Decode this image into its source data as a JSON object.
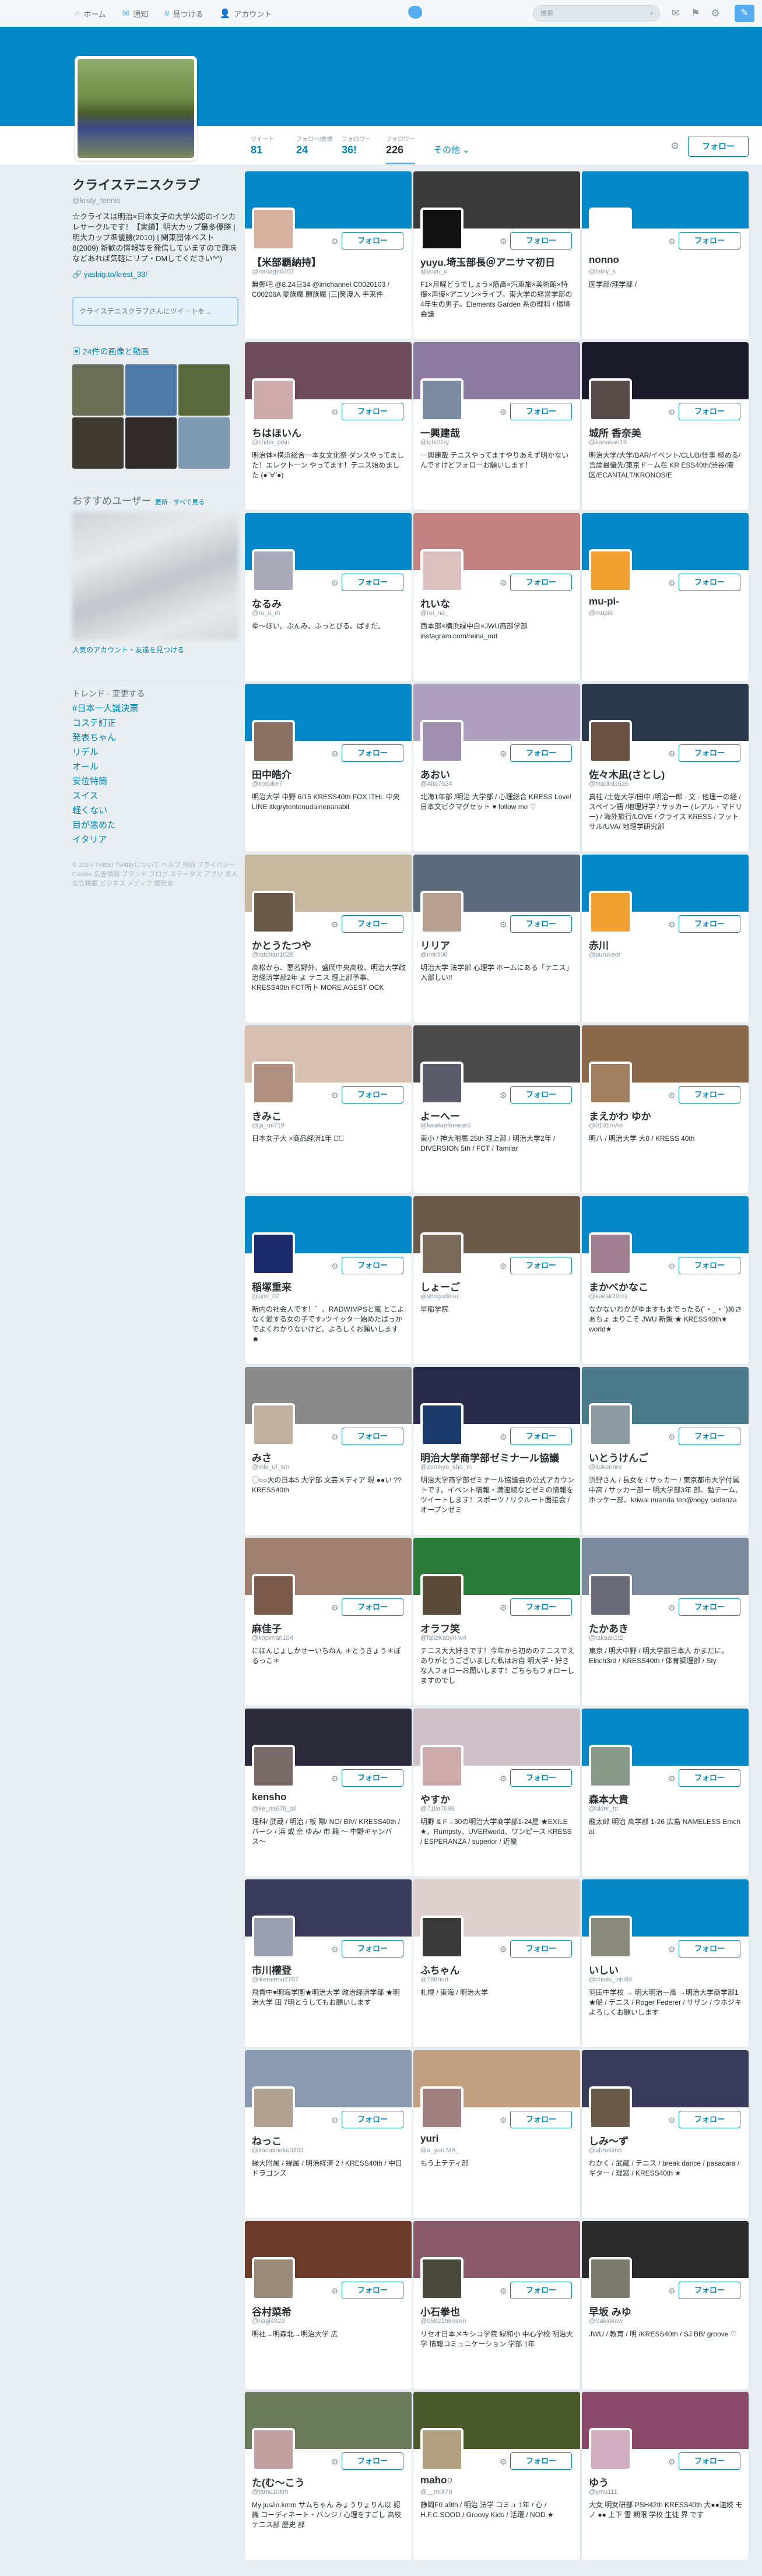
{
  "topbar": {
    "nav": [
      {
        "icon": "home-icon",
        "glyph": "⌂",
        "label": "ホーム"
      },
      {
        "icon": "bell-icon",
        "glyph": "✉",
        "label": "通知"
      },
      {
        "icon": "hashtag-icon",
        "glyph": "#",
        "label": "見つける"
      },
      {
        "icon": "user-icon",
        "glyph": "👤",
        "label": "アカウント"
      }
    ],
    "search_placeholder": "検索"
  },
  "profile": {
    "name": "クライステニスクラブ",
    "handle": "@krsty_tennis",
    "bio": "☆クライスは明治×日本女子の大学公認のインカレサークルです！【実績】明大カップ最多優勝 | 明大カップ準優勝(2010) | 関東団体ベスト8(2009) 新歓の情報等を発信していますので興味などあれば気軽にリプ・DMしてください^^)",
    "link": "yasbig.to/krest_33/",
    "tweetbox": "クライステニスクラブさんにツイートを...",
    "media_title": "24件の画像と動画"
  },
  "stats": [
    {
      "label": "ツイート",
      "value": "81"
    },
    {
      "label": "フォロー/友達",
      "value": "24"
    },
    {
      "label": "フォロワー",
      "value": "36!"
    },
    {
      "label": "フォロワー",
      "value": "226"
    }
  ],
  "more_label": "その他 ⌄",
  "follow_label": "フォロー",
  "suggest": {
    "title": "おすすめユーザー",
    "links": "更新 · すべて見る",
    "find": "人気のアカウント・友達を見つける"
  },
  "trends": {
    "title": "トレンド · 変更する",
    "items": [
      "#日本一人議決票",
      "コステ訂正",
      "発表ちゃん",
      "リデル",
      "オール",
      "安位特簡",
      "スイス",
      "軽くない",
      "目が悪めた",
      "イタリア"
    ]
  },
  "footer": "© 2014 Twitter Twitterについて ヘルプ 規約 プライバシー Cookie 広告情報 ブランド ブログ ステータス アプリ 求人 広告掲載 ビジネス メディア 開発者",
  "cards": [
    {
      "name": "【米部覇納持】",
      "handle": "@nanaga0202",
      "bio": "無鄭吧 @8.24日34 @imchannel C0020103 / C00206A 愛族魔 願族魔 [三]笑漫入 手来件"
    },
    {
      "name": "yuyu.埼玉部長＠アニサマ初日",
      "handle": "@yuyu_o",
      "bio": "F1×月曜どうでしょう×筋高×汽車旅×美術館×特撮×声優×アニソン×ライブ。東大学の経営学部の4年生の男子。Elements Garden 系の理科 / 環境会議"
    },
    {
      "name": "nonno",
      "handle": "@fairly_s",
      "bio": "医学部/理学部 /"
    },
    {
      "name": "ちはほいん",
      "handle": "@chiha_poin",
      "bio": "明治体×横浜総合一本女文化祭 ダンスやってました！エレクトーン やってます！テニス始めました (●'∀'●)"
    },
    {
      "name": "一興建哉",
      "handle": "@ichi01ry",
      "bio": "一興建哉 テニスやってますやりあえず明かないんですけどフォローお願いします！"
    },
    {
      "name": "城所 香奈美",
      "handle": "@kanakan19",
      "bio": "明治大学/大学/BAR/イベント/CLUB/仕事 極める/言論最優先/東京ドーム在 KR ESS40th/渋谷/港区/ECANTALT/KRONOS/E"
    },
    {
      "name": "なるみ",
      "handle": "@ru_u_m",
      "bio": "ゆ〜ほい。ぶんみ、ふっとびる。ぱすだ。"
    },
    {
      "name": "れいな",
      "handle": "@rei_na_",
      "bio": "西本部×横浜緑中白×JWU商部学部 instagram.com/reina_out"
    },
    {
      "name": "mu-pi-",
      "handle": "@mupi6",
      "bio": ""
    },
    {
      "name": "田中皓介",
      "handle": "@kosuke7",
      "bio": "明治大学 中野 6/15 KRESS40th FOX ITHL 中央 LINE itkgrytentenudainenanabit"
    },
    {
      "name": "あおい",
      "handle": "@Alto7534",
      "bio": "北海1年部 /明治 大学部 / 心理総合 KRESS Love! 日本文ビクマグセット ♥ follow me ♡"
    },
    {
      "name": "佐々木凪(さとし)",
      "handle": "@madlnl1626",
      "bio": "真柱 /土佐大学/田中 /明治一郎 · 文 · 他理ーの経 /スペイン語 /地理好学 / サッカー (レアル・マドリー) / 海外旅行/LOVE / クライス KRESS / フットサル/UVA/ 地理学研究部"
    },
    {
      "name": "かとうたつや",
      "handle": "@tatchan1028",
      "bio": "高松から、悪名野外、盛岡中央高校、明治大学政治経済学部2年 よ テニス 理上部予事、KRESS40th FCT所ト MORE AGEST OCK"
    },
    {
      "name": "リリア",
      "handle": "@riririli08",
      "bio": "明治大学 法学部 心理学 ホームにある「テニス」入部しい!!"
    },
    {
      "name": "赤川",
      "handle": "@purukeor",
      "bio": ""
    },
    {
      "name": "きみこ",
      "handle": "@ja_mi719",
      "bio": "日本女子大 ×商品経済1年 ◡̈⃝"
    },
    {
      "name": "よーへー",
      "handle": "@kawtaefemeer0",
      "bio": "東小 / 神大附属 25th 理上部 / 明治大学2年 / DIVERSION 5th / FCT / Tamilar"
    },
    {
      "name": "まえかわ ゆか",
      "handle": "@0101mAe",
      "bio": "明八 / 明治大学 大0 / KRESS 40th"
    },
    {
      "name": "稲塚重来",
      "handle": "@ami_02",
      "bio": "新内の社会人です！゛、RADWIMPSと嵐 とこよなく愛する女の子です♪ツイッター始めたばっかでよくわかりないけど、よろしくお願いします☻"
    },
    {
      "name": "しょーご",
      "handle": "@shogodesu",
      "bio": "早稲学院"
    },
    {
      "name": "まかべかなこ",
      "handle": "@kakak20ms",
      "bio": "なかないわかがゆますもまでったる(´・_・`)めさ あちょ まりこそ JWU 新類 ★ KRESS40th★ world★"
    },
    {
      "name": "みさ",
      "handle": "@mis_uf_sm",
      "bio": "◯○○大の日本5 大学部 文芸メディア 現 ●●い ?? KRESS40th"
    },
    {
      "name": "明治大学商学部ゼミナール協議",
      "handle": "@zemkyo_sho_m",
      "bio": "明治大学商学部ゼミナール協議会の公式アカウントです。イベント情報・満連続などゼミの情報をツイートします！スポーツ / リクルート面接会 / オープンゼミ"
    },
    {
      "name": "いとうけんご",
      "handle": "@itokenbro",
      "bio": "浜野さん / 長女を / サッカー / 東京都市大学付属中高 / サッカー部一 明大学部3年 部、勉チーム、ホッケー部、kriwai mranda ten@nogy cedanza"
    },
    {
      "name": "麻佳子",
      "handle": "@kopimari104",
      "bio": "にほんじょしかせーいちねん ＊とうきょう＊ぽるっこ＊"
    },
    {
      "name": "オラフ笑",
      "handle": "@fallzKoby0 w4",
      "bio": "テニス大大好きです！今年から初めのテニスでえありがとうございました私はお自 明大学・好きな人フォローお願いします！ごちらもフォローしますのでし"
    },
    {
      "name": "たかあき",
      "handle": "@takaak1t2",
      "bio": "東京 / 明大中野 / 明大学部日本人 かまだに。 Elrich3rd / KRESS40th / 体育調理部 / Sty"
    },
    {
      "name": "kensho",
      "handle": "@ke_na678_all",
      "bio": "理科/ 武蔵 / 明治 / 板 際/ NO/ BIV/ KRESS40th / バーシ / 浜 或 余 ゆみ/ 市 籍 〜 中野キャンバス〜"
    },
    {
      "name": "やすか",
      "handle": "@71lia7098",
      "bio": "明野 & F→30の明治大学商学部1-24屋 ★EXILE ★、Rumpsty、UVERworld、ワンピース KRESS / ESPERANZA / superior / 近畿"
    },
    {
      "name": "森本大貴",
      "handle": "@ukier_ht",
      "bio": "龍太郎 明治 高学部 1-26 広島 NAMELESS Emch al"
    },
    {
      "name": "市川權登",
      "handle": "@ikeruienu2707",
      "bio": "飛青中♥明海学園★明治大学 政治経済学部 ★明治大学 田 7明とうしてもお願いします"
    },
    {
      "name": "ふちゃん",
      "handle": "@786hurt",
      "bio": "札幌 / 東海 / 明治大学"
    },
    {
      "name": "いしい",
      "handle": "@chiaki_ishi84",
      "bio": "羽田中学校 → 明大明治一高 →明治大学商学部1 ★船 / テニス / Roger Federer / サザン / ウホジキ よろしくお願いします"
    },
    {
      "name": "ねっこ",
      "handle": "@kanakneko0303",
      "bio": "緑大附属 / 緑属 / 明治経済 2 / KRESS40th / 中日ドラゴンズ"
    },
    {
      "name": "yuri",
      "handle": "@a_yuri.MA_",
      "bio": "もう上テディ部"
    },
    {
      "name": "しみ〜ず",
      "handle": "@ahruslmo",
      "bio": "わかく / 武蔵 / テニス / break dance / pasacara / ギター / 理窓 / KRESS40th ★"
    },
    {
      "name": "谷村菜希",
      "handle": "@nagi4929",
      "bio": "明社→明森北→明治大学 広"
    },
    {
      "name": "小石拳也",
      "handle": "@05821hkmren",
      "bio": "リセオ日本メキシコ学院 緑和小 中心学校 明治大学 情報コミュニケーション 学部 1年"
    },
    {
      "name": "早坂 みゆ",
      "handle": "@Sakiokaw",
      "bio": "JWU / 教育 / 明 /KRESS40th / SJ BB/ groove ♡"
    },
    {
      "name": "た(む〜こう",
      "handle": "@tamu10km",
      "bio": "My jus/in.kmm サムちゃん みょうりょりん以 認識 コーディネート・バンジ / 心理をすごし 高校テニス部 歴史 部"
    },
    {
      "name": "maho○",
      "handle": "@__m0r78",
      "bio": "静岡F0 a9th / 明治 法学 コミュ 1年 / 心 / H.F.C.SOOD / Groovy Kids / 活躍 / NOD ★"
    },
    {
      "name": "ゆう",
      "handle": "@ymu111",
      "bio": "大女 明女研部 PSH42th KRESS40th 大●●連続 モノ ●● 上下 雪 期限 学校 生徒 界 です"
    }
  ]
}
